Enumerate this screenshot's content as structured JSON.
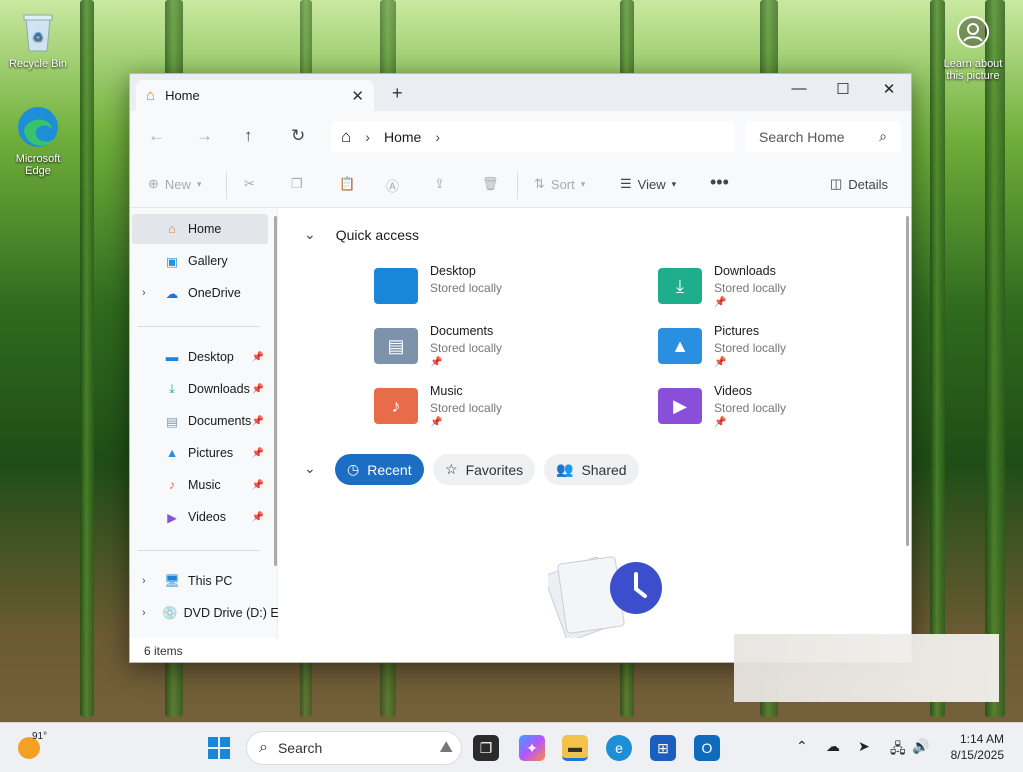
{
  "desktop": {
    "recycle_bin": "Recycle Bin",
    "edge": "Microsoft Edge",
    "learn_about": "Learn about this picture"
  },
  "window": {
    "tab_title": "Home",
    "breadcrumb_home": "Home",
    "search_placeholder": "Search Home",
    "cmd": {
      "new": "New",
      "sort": "Sort",
      "view": "View",
      "details": "Details"
    },
    "sidebar": {
      "items": [
        {
          "label": "Home",
          "icon": "home-icon"
        },
        {
          "label": "Gallery",
          "icon": "gallery-icon"
        },
        {
          "label": "OneDrive",
          "icon": "cloud-icon"
        },
        {
          "label": "Desktop",
          "icon": "desktop-folder-icon"
        },
        {
          "label": "Downloads",
          "icon": "download-icon"
        },
        {
          "label": "Documents",
          "icon": "documents-icon"
        },
        {
          "label": "Pictures",
          "icon": "pictures-icon"
        },
        {
          "label": "Music",
          "icon": "music-icon"
        },
        {
          "label": "Videos",
          "icon": "videos-icon"
        },
        {
          "label": "This PC",
          "icon": "pc-icon"
        },
        {
          "label": "DVD Drive (D:) E",
          "icon": "dvd-icon"
        }
      ]
    },
    "quick_access": {
      "heading": "Quick access",
      "items": [
        {
          "name": "Desktop",
          "sub": "Stored locally",
          "color": "#1a86d9"
        },
        {
          "name": "Downloads",
          "sub": "Stored locally",
          "color": "#1fae8c"
        },
        {
          "name": "Documents",
          "sub": "Stored locally",
          "color": "#7d93ab"
        },
        {
          "name": "Pictures",
          "sub": "Stored locally",
          "color": "#2a8fe0"
        },
        {
          "name": "Music",
          "sub": "Stored locally",
          "color": "#e86b4a"
        },
        {
          "name": "Videos",
          "sub": "Stored locally",
          "color": "#8a4fd8"
        }
      ]
    },
    "filters": {
      "recent": "Recent",
      "favorites": "Favorites",
      "shared": "Shared"
    },
    "status": "6 items"
  },
  "taskbar": {
    "weather": "91°",
    "search": "Search",
    "time": "1:14 AM",
    "date": "8/15/2025"
  }
}
